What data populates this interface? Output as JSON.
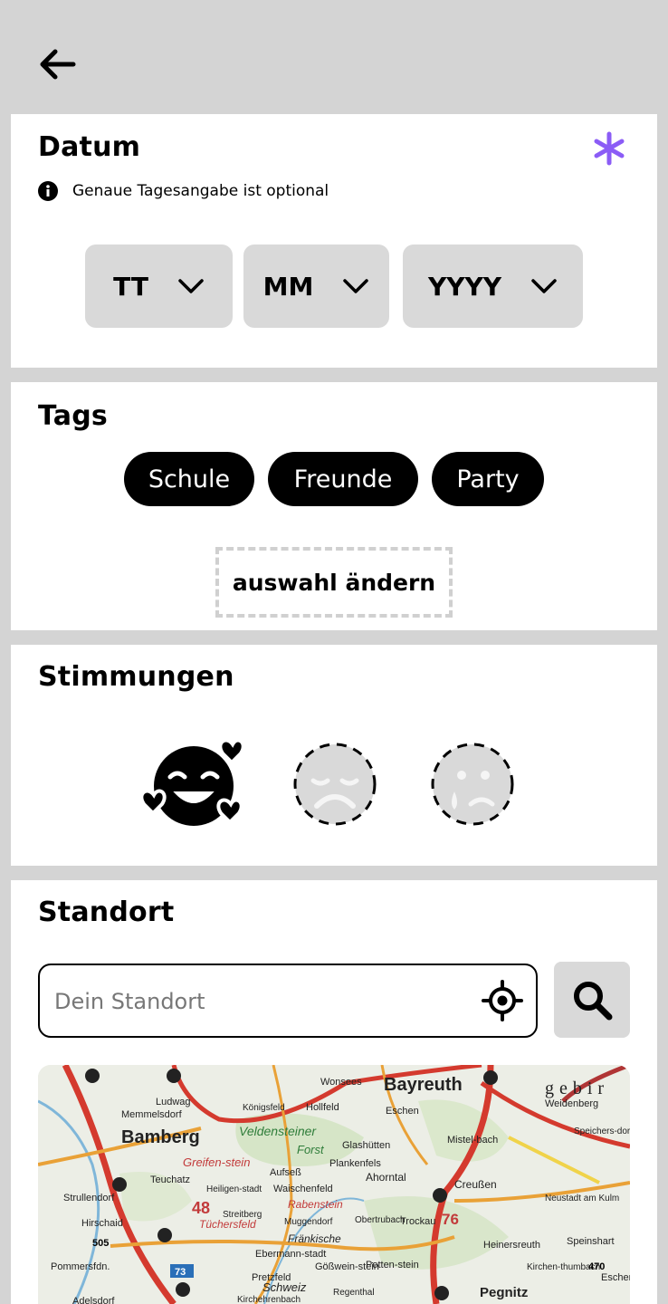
{
  "datum": {
    "title": "Datum",
    "info_text": "Genaue Tagesangabe ist optional",
    "day_label": "TT",
    "month_label": "MM",
    "year_label": "YYYY"
  },
  "tags": {
    "title": "Tags",
    "chips": [
      "Schule",
      "Freunde",
      "Party"
    ],
    "change_label": "auswahl ändern"
  },
  "moods": {
    "title": "Stimmungen",
    "options": [
      "smiling-face-with-hearts-icon",
      "sad-face-icon",
      "crying-face-icon"
    ],
    "selected": "smiling-face-with-hearts-icon"
  },
  "standort": {
    "title": "Standort",
    "search_placeholder": "Dein Standort",
    "search_value": ""
  },
  "map": {
    "labels": {
      "bayreuth": "Bayreuth",
      "bamberg": "Bamberg",
      "pegnitz": "Pegnitz",
      "veldensteiner": "Veldensteiner",
      "forst": "Forst",
      "rabenstein": "Rabenstein",
      "fraenkische": "Fränkische",
      "schweiz": "Schweiz",
      "wonsees": "Wonsees",
      "hollfeld": "Hollfeld",
      "memmelsdorf": "Memmelsdorf",
      "ludwag": "Ludwag",
      "koenigsfeld": "Königsfeld",
      "glashuetten": "Glashütten",
      "plankenfels": "Plankenfels",
      "ahorntal": "Ahorntal",
      "creussen": "Creußen",
      "weidenberg": "Weidenberg",
      "speichersdorf": "Speichers-dorf",
      "neustadt": "Neustadt am Kulm",
      "speinshart": "Speinshart",
      "teuchatz": "Teuchatz",
      "heiligenstadt": "Heiligen-stadt",
      "streitberg": "Streitberg",
      "muggendorf": "Muggendorf",
      "aufsess": "Aufseß",
      "waischenfeld": "Waischenfeld",
      "hirschaid": "Hirschaid",
      "strullendorf": "Strullendorf",
      "pommersfelden": "Pommersfdn.",
      "ebermannstadt": "Ebermann-stadt",
      "pretzfeld": "Pretzfeld",
      "goessweinstein": "Gößwein-stein",
      "pottenstein": "Potten-stein",
      "heinersreuth": "Heinersreuth",
      "trockau": "Trockau",
      "obertrubach": "Obertrubach",
      "kirchenthumbach": "Kirchen-thumbach",
      "eschenbach": "Escher",
      "mistelbach": "Mistel-bach",
      "eckersdorf": "Eschen",
      "tuechersfeld": "Tüchersfeld",
      "greifenstein": "Greifen-stein",
      "adelsdorf": "Adelsdorf",
      "kirchehrenbach": "Kirchehrenbach",
      "regenthal": "Regenthal",
      "gefrees": "gebir",
      "road_48": "48",
      "road_76": "76",
      "road_470": "470",
      "road_505": "505",
      "road_73": "73"
    }
  },
  "colors": {
    "accent": "#8b5cf6",
    "chip_bg": "#000000",
    "select_bg": "#d9d9d9",
    "divider": "#d4d4d4"
  }
}
